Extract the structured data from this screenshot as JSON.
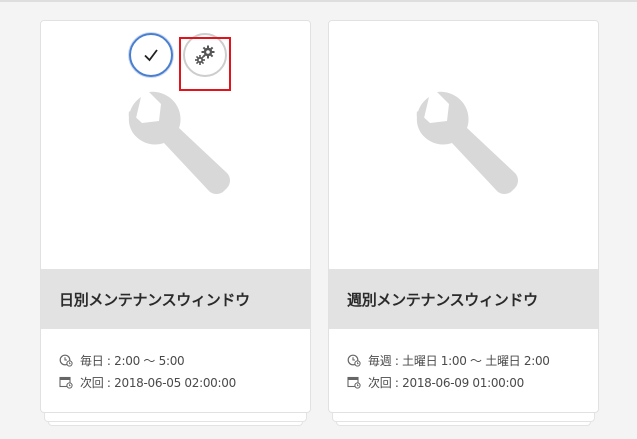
{
  "cards": [
    {
      "title": "日別メンテナンスウィンドウ",
      "schedule": "毎日 : 2:00 〜 5:00",
      "next_run": "次回 : 2018-06-05 02:00:00",
      "selected": true,
      "icons": {
        "preview": "wrench-icon",
        "check": "checkmark-icon",
        "settings": "gears-icon",
        "schedule": "clock-icon",
        "next": "calendar-icon"
      }
    },
    {
      "title": "週別メンテナンスウィンドウ",
      "schedule": "毎週 : 土曜日 1:00 〜 土曜日 2:00",
      "next_run": "次回 : 2018-06-09 01:00:00",
      "selected": false,
      "icons": {
        "preview": "wrench-icon",
        "schedule": "clock-icon",
        "next": "calendar-icon"
      }
    }
  ],
  "colors": {
    "background": "#f4f4f4",
    "title_bar": "#e2e2e2",
    "selected_ring": "#4a7fd0",
    "highlight": "#e3131b",
    "icon_gray": "#d8d8d8"
  }
}
